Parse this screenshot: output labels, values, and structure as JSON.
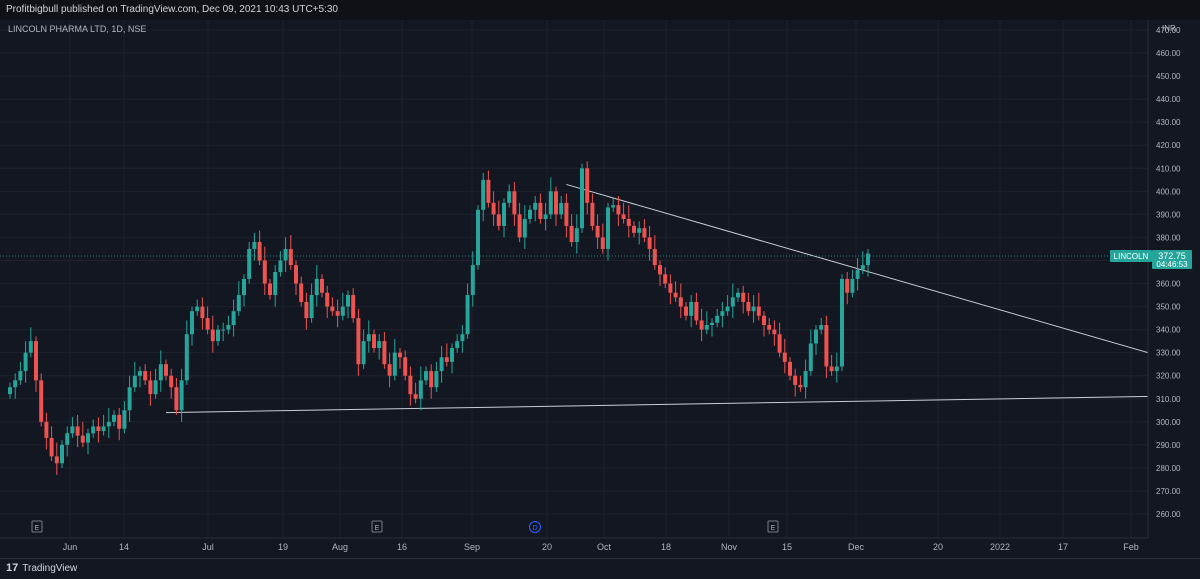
{
  "header": {
    "published_by": "Profitbigbull published on TradingView.com, Dec 09, 2021 10:43 UTC+5:30"
  },
  "symbol": {
    "title": "LINCOLN PHARMA LTD, 1D, NSE"
  },
  "price_axis": {
    "currency": "INR",
    "ticks": [
      "470.00",
      "460.00",
      "450.00",
      "440.00",
      "430.00",
      "420.00",
      "410.00",
      "400.00",
      "390.00",
      "380.00",
      "370.00",
      "360.00",
      "350.00",
      "340.00",
      "330.00",
      "320.00",
      "310.00",
      "300.00",
      "290.00",
      "280.00",
      "270.00",
      "260.00"
    ]
  },
  "time_axis": {
    "labels": [
      "Jun",
      "14",
      "Jul",
      "19",
      "Aug",
      "16",
      "Sep",
      "20",
      "Oct",
      "18",
      "Nov",
      "15",
      "Dec",
      "20",
      "2022",
      "17",
      "Feb"
    ]
  },
  "last_price": {
    "ticker": "LINCOLN",
    "price": "372.75",
    "countdown": "04:46:53"
  },
  "event_markers": [
    "E",
    "E",
    "D",
    "E"
  ],
  "footer": {
    "brand": "TradingView",
    "logo_mark": "17"
  },
  "colors": {
    "up": "#26a69a",
    "down": "#ef5350",
    "background": "#131722",
    "trendline": "#c9ccd4"
  },
  "chart_data": {
    "type": "candlestick",
    "title": "LINCOLN PHARMA LTD, 1D, NSE",
    "ylabel": "INR",
    "ylim": [
      255,
      471
    ],
    "grid": true,
    "series": [
      {
        "name": "LINCOLN",
        "closes": [
          315,
          318,
          322,
          330,
          335,
          318,
          300,
          293,
          285,
          282,
          290,
          295,
          298,
          294,
          291,
          295,
          298,
          296,
          298,
          300,
          303,
          297,
          305,
          315,
          320,
          322,
          318,
          312,
          318,
          325,
          320,
          315,
          305,
          318,
          338,
          348,
          350,
          345,
          340,
          335,
          340,
          340,
          342,
          348,
          355,
          362,
          375,
          378,
          370,
          360,
          355,
          365,
          370,
          375,
          368,
          360,
          352,
          345,
          355,
          362,
          356,
          350,
          348,
          346,
          350,
          355,
          345,
          325,
          335,
          338,
          332,
          335,
          325,
          320,
          330,
          328,
          320,
          312,
          310,
          318,
          322,
          315,
          322,
          328,
          326,
          332,
          335,
          338,
          355,
          368,
          392,
          405,
          395,
          390,
          385,
          395,
          400,
          390,
          380,
          388,
          392,
          395,
          388,
          390,
          400,
          390,
          395,
          385,
          378,
          384,
          410,
          395,
          385,
          380,
          375,
          393,
          394,
          390,
          388,
          385,
          382,
          384,
          380,
          375,
          368,
          364,
          360,
          356,
          354,
          350,
          346,
          352,
          344,
          340,
          342,
          343,
          346,
          348,
          350,
          354,
          356,
          352,
          348,
          350,
          346,
          342,
          340,
          338,
          330,
          326,
          320,
          316,
          315,
          322,
          334,
          340,
          342,
          324,
          322,
          324,
          362,
          356,
          362,
          366,
          368,
          373
        ],
        "trendlines": [
          {
            "from": {
              "index": 30,
              "value": 304
            },
            "to_value_at_right_edge": 311
          },
          {
            "from": {
              "index": 107,
              "value": 403
            },
            "to_value_at_right_edge": 330
          }
        ],
        "last_value": 372.75
      }
    ]
  }
}
